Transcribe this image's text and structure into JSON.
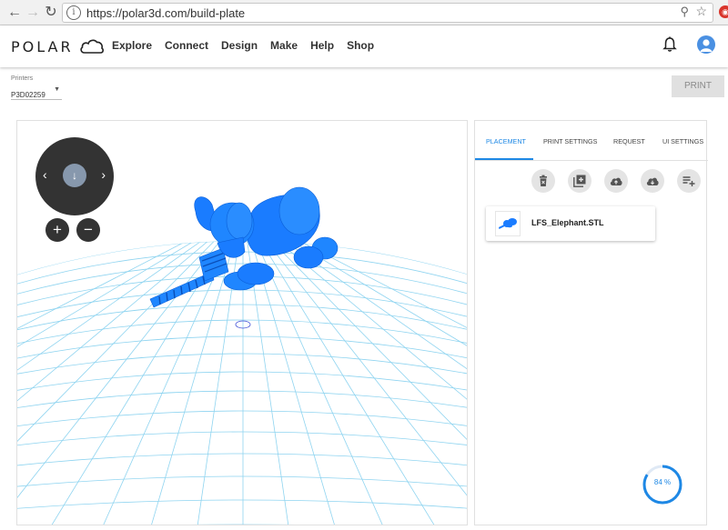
{
  "browser": {
    "url": "https://polar3d.com/build-plate",
    "back_icon": "arrow-left-icon",
    "forward_icon": "arrow-right-icon",
    "reload_icon": "reload-icon"
  },
  "header": {
    "logo_text": "POLAR",
    "nav": [
      {
        "label": "Explore"
      },
      {
        "label": "Connect"
      },
      {
        "label": "Design"
      },
      {
        "label": "Make"
      },
      {
        "label": "Help"
      },
      {
        "label": "Shop"
      }
    ]
  },
  "printers": {
    "label": "Printers",
    "selected": "P3D02259"
  },
  "print_button": "PRINT",
  "viewer": {
    "zoom_in": "+",
    "zoom_out": "−",
    "pan_left": "‹",
    "pan_right": "›",
    "model_color": "#1a7cff",
    "grid_color": "#8fd4f0"
  },
  "panel": {
    "tabs": [
      {
        "label": "PLACEMENT",
        "active": true
      },
      {
        "label": "PRINT SETTINGS"
      },
      {
        "label": "REQUEST"
      },
      {
        "label": "UI SETTINGS"
      }
    ],
    "actions": [
      "trash-icon",
      "add-copy-icon",
      "cloud-upload-icon",
      "cloud-download-icon",
      "playlist-add-icon"
    ],
    "files": [
      {
        "name": "LFS_Elephant.STL"
      }
    ],
    "progress": {
      "value": 84,
      "label": "84 %"
    }
  },
  "colors": {
    "accent": "#1e88e5",
    "model": "#1a7cff"
  }
}
